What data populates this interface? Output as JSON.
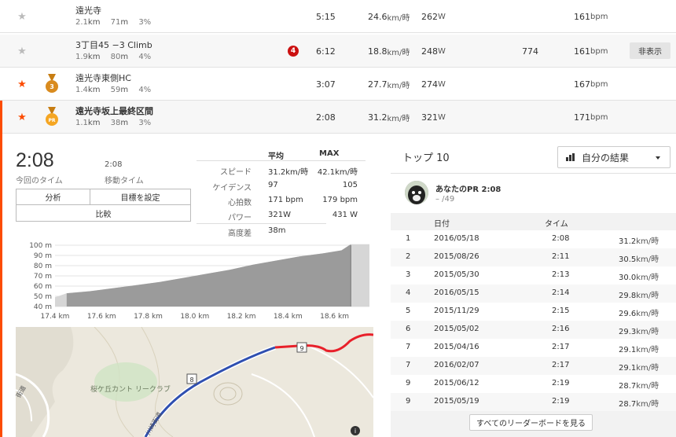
{
  "segments": [
    {
      "starred": false,
      "medal": "",
      "name": "遠光寺",
      "bold": false,
      "distance": "2.1",
      "distance_unit": "km",
      "elevation": "71",
      "elevation_unit": "m",
      "grade": "3%",
      "badge": "",
      "time": "5:15",
      "speed": "24.6",
      "speed_unit": "km/時",
      "power": "262",
      "power_unit": "W",
      "extra": "",
      "hr": "161",
      "hr_unit": "bpm",
      "hide": ""
    },
    {
      "starred": false,
      "medal": "",
      "name": "3丁目45 −3 Climb",
      "bold": false,
      "distance": "1.9",
      "distance_unit": "km",
      "elevation": "80",
      "elevation_unit": "m",
      "grade": "4%",
      "badge": "4",
      "time": "6:12",
      "speed": "18.8",
      "speed_unit": "km/時",
      "power": "248",
      "power_unit": "W",
      "extra": "774",
      "hr": "161",
      "hr_unit": "bpm",
      "hide": "非表示"
    },
    {
      "starred": true,
      "medal": "3",
      "name": "遠光寺東側HC",
      "bold": false,
      "distance": "1.4",
      "distance_unit": "km",
      "elevation": "59",
      "elevation_unit": "m",
      "grade": "4%",
      "badge": "",
      "time": "3:07",
      "speed": "27.7",
      "speed_unit": "km/時",
      "power": "274",
      "power_unit": "W",
      "extra": "",
      "hr": "167",
      "hr_unit": "bpm",
      "hide": ""
    },
    {
      "starred": true,
      "medal": "PR",
      "name": "遠光寺坂上最終区間",
      "bold": true,
      "distance": "1.1",
      "distance_unit": "km",
      "elevation": "38",
      "elevation_unit": "m",
      "grade": "3%",
      "badge": "",
      "time": "2:08",
      "speed": "31.2",
      "speed_unit": "km/時",
      "power": "321",
      "power_unit": "W",
      "extra": "",
      "hr": "171",
      "hr_unit": "bpm",
      "hide": ""
    }
  ],
  "detail": {
    "current_time": "2:08",
    "current_time_label": "今回のタイム",
    "moving_time": "2:08",
    "moving_time_label": "移動タイム",
    "buttons": {
      "analysis": "分析",
      "set_goal": "目標を設定",
      "compare": "比較"
    },
    "stats": {
      "head_avg": "平均",
      "head_max": "MAX",
      "rows": [
        {
          "label": "スピード",
          "avg": "31.2km/時",
          "max": "42.1km/時"
        },
        {
          "label": "ケイデンス",
          "avg": "97",
          "max": "105"
        },
        {
          "label": "心拍数",
          "avg": "171 bpm",
          "max": "179 bpm"
        },
        {
          "label": "パワー",
          "avg": "321W",
          "max": "431 W"
        },
        {
          "label": "高度差",
          "avg": "38m",
          "max": ""
        }
      ]
    }
  },
  "colors": {
    "accent": "#fc4c02",
    "badge": "#cc1111",
    "route_blue": "#2f4fb0",
    "route_red": "#e8202a"
  },
  "chart_data": {
    "type": "area",
    "title": "",
    "xlabel": "",
    "ylabel": "",
    "y_ticks": [
      "100 m",
      "90 m",
      "80 m",
      "70 m",
      "60 m",
      "50 m",
      "40 m"
    ],
    "x_ticks": [
      "17.4 km",
      "17.6 km",
      "17.8 km",
      "18.0 km",
      "18.2 km",
      "18.4 km",
      "18.6 km"
    ],
    "ylim": [
      40,
      100
    ],
    "xlim": [
      17.4,
      18.75
    ],
    "grid": true,
    "series": [
      {
        "x": [
          17.4,
          17.45,
          17.55,
          17.65,
          17.75,
          17.85,
          17.95,
          18.05,
          18.15,
          18.25,
          18.35,
          18.45,
          18.55,
          18.63,
          18.67,
          18.75
        ],
        "y": [
          49,
          53,
          55,
          58,
          61,
          64,
          68,
          72,
          76,
          81,
          85,
          89,
          92,
          95,
          101,
          101
        ]
      }
    ],
    "highlight_range": [
      17.45,
      18.67
    ]
  },
  "map": {
    "labels": [
      "8",
      "9",
      "桜ケ丘カント リークラブ",
      "川崎街道",
      "街道"
    ],
    "info_icon": "info-icon"
  },
  "leaderboard": {
    "title": "トップ 10",
    "filter": "自分の結果",
    "pr_label": "あなたのPR 2:08",
    "pr_rank": "– /49",
    "col_date": "日付",
    "col_time": "タイム",
    "rows": [
      {
        "rank": "1",
        "date": "2016/05/18",
        "time": "2:08",
        "speed": "31.2",
        "unit": "km/時"
      },
      {
        "rank": "2",
        "date": "2015/08/26",
        "time": "2:11",
        "speed": "30.5",
        "unit": "km/時"
      },
      {
        "rank": "3",
        "date": "2015/05/30",
        "time": "2:13",
        "speed": "30.0",
        "unit": "km/時"
      },
      {
        "rank": "4",
        "date": "2016/05/15",
        "time": "2:14",
        "speed": "29.8",
        "unit": "km/時"
      },
      {
        "rank": "5",
        "date": "2015/11/29",
        "time": "2:15",
        "speed": "29.6",
        "unit": "km/時"
      },
      {
        "rank": "6",
        "date": "2015/05/02",
        "time": "2:16",
        "speed": "29.3",
        "unit": "km/時"
      },
      {
        "rank": "7",
        "date": "2015/04/16",
        "time": "2:17",
        "speed": "29.1",
        "unit": "km/時"
      },
      {
        "rank": "7",
        "date": "2016/02/07",
        "time": "2:17",
        "speed": "29.1",
        "unit": "km/時"
      },
      {
        "rank": "9",
        "date": "2015/06/12",
        "time": "2:19",
        "speed": "28.7",
        "unit": "km/時"
      },
      {
        "rank": "9",
        "date": "2015/05/19",
        "time": "2:19",
        "speed": "28.7",
        "unit": "km/時"
      }
    ],
    "view_all": "すべてのリーダーボードを見る"
  }
}
